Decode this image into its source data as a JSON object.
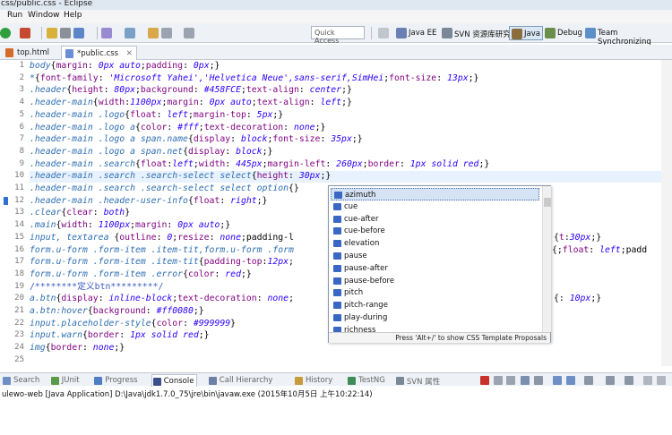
{
  "window": {
    "title": "css/public.css - Eclipse"
  },
  "menu": [
    "Run",
    "Window",
    "Help"
  ],
  "toolbar": {
    "quick_access": "Quick Access",
    "perspectives": [
      {
        "label": "Java EE",
        "icon": "java-ee-perspective-icon",
        "active": false
      },
      {
        "label": "SVN 资源库研究",
        "icon": "svn-perspective-icon",
        "active": false
      },
      {
        "label": "Java",
        "icon": "java-perspective-icon",
        "active": true
      },
      {
        "label": "Debug",
        "icon": "debug-perspective-icon",
        "active": false
      },
      {
        "label": "Team Synchronizing",
        "icon": "team-sync-perspective-icon",
        "active": false
      }
    ]
  },
  "editor_tabs": [
    {
      "label": "top.html",
      "active": false
    },
    {
      "label": "*public.css",
      "active": true
    }
  ],
  "editor": {
    "current_line": 11,
    "lines": [
      "body{margin: 0px auto;padding: 0px;}",
      "*{font-family: 'Microsoft Yahei','Helvetica Neue',sans-serif,SimHei;font-size: 13px;}",
      ".header{height: 80px;background: #458FCE;text-align: center;}",
      ".header-main{width:1100px;margin: 0px auto;text-align: left;}",
      ".header-main .logo{float: left;margin-top: 5px;}",
      ".header-main .logo a{color: #fff;text-decoration: none;}",
      ".header-main .logo a span.name{display: block;font-size: 35px;}",
      ".header-main .logo a span.net{display: block;}",
      ".header-main .search{float:left;width: 445px;margin-left: 260px;border: 1px solid red;}",
      ".header-main .search .search-select select{height: 30px;}",
      ".header-main .search .search-select select option{}",
      ".header-main .header-user-info{float: right;}",
      ".clear{clear: both}",
      ".main{width: 1100px;margin: 0px auto;}",
      "input, textarea {outline: 0;resize: none;padding-l",
      "form.u-form .form-item .item-tit,form.u-form .form",
      "form.u-form .form-item .item-tit{padding-top:12px;",
      "form.u-form .form-item .error{color: red;}",
      "/********定义btn*********/",
      "a.btn{display: inline-block;text-decoration: none;",
      "a.btn:hover{background: #ff0080;}",
      "input.placeholder-style{color: #999999}",
      "input.warn{border: 1px solid red;}",
      "img{border: none;}",
      ""
    ],
    "overflow_fragments": [
      {
        "line": 15,
        "text": "t:30px;}"
      },
      {
        "line": 16,
        "text": ";float: left;padd"
      },
      {
        "line": 20,
        "text": ": 10px;}"
      }
    ]
  },
  "content_assist": {
    "proposals": [
      "azimuth",
      "cue",
      "cue-after",
      "cue-before",
      "elevation",
      "pause",
      "pause-after",
      "pause-before",
      "pitch",
      "pitch-range",
      "play-during",
      "richness"
    ],
    "selected_index": 0,
    "footer": "Press 'Alt+/' to show CSS Template Proposals"
  },
  "bottom_tabs": [
    {
      "label": "Search",
      "icon": "search-icon",
      "active": false
    },
    {
      "label": "JUnit",
      "icon": "junit-icon",
      "active": false
    },
    {
      "label": "Progress",
      "icon": "progress-icon",
      "active": false
    },
    {
      "label": "Console",
      "icon": "console-icon",
      "active": true
    },
    {
      "label": "Call Hierarchy",
      "icon": "call-hierarchy-icon",
      "active": false
    },
    {
      "label": "History",
      "icon": "history-icon",
      "active": false
    },
    {
      "label": "TestNG",
      "icon": "testng-icon",
      "active": false
    },
    {
      "label": "SVN 属性",
      "icon": "svn-properties-icon",
      "active": false
    }
  ],
  "console": {
    "description": "ulewo-web [Java Application] D:\\Java\\jdk1.7.0_75\\jre\\bin\\javaw.exe (2015年10月5日 上午10:22:14)"
  },
  "colors": {
    "selector": "#2e6fb2",
    "property": "#7f007f",
    "value": "#2a00ff",
    "comment": "#3f5fbf",
    "current_line": "#e8f2fe",
    "selection_highlight": "#d6e3f5"
  }
}
